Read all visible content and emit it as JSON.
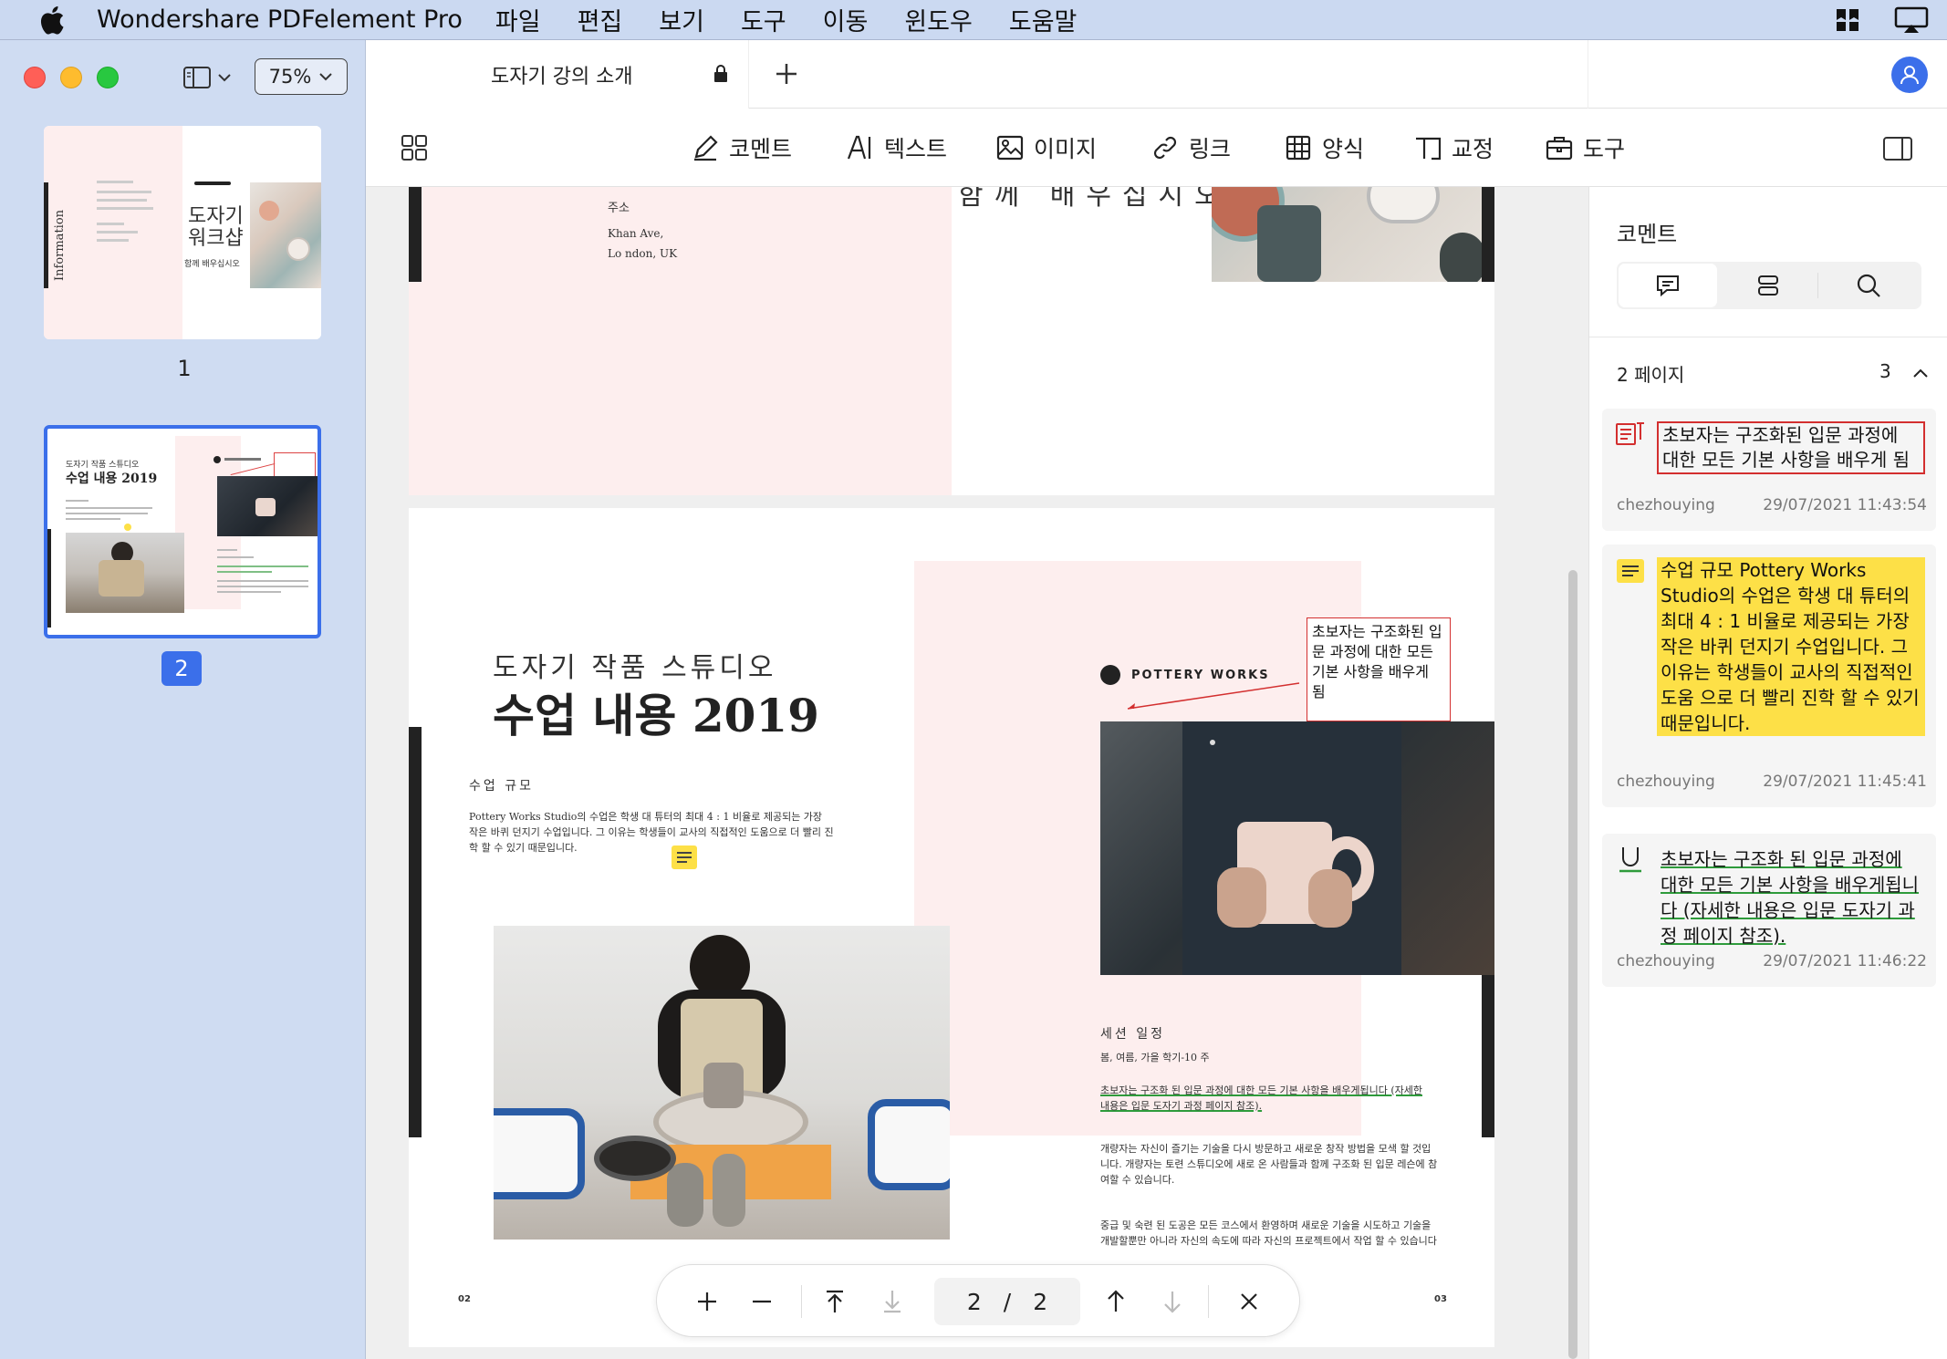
{
  "menubar": {
    "app_name": "Wondershare PDFelement Pro",
    "menus": [
      "파일",
      "편집",
      "보기",
      "도구",
      "이동",
      "윈도우",
      "도움말"
    ]
  },
  "sidebar": {
    "zoom": "75%",
    "thumbnails": [
      {
        "number": "1",
        "selected": false,
        "vertical_text": "Information",
        "title_lines": [
          "도자기",
          "워크샵"
        ],
        "subtitle": "함께 배우십시오"
      },
      {
        "number": "2",
        "selected": true,
        "heading_small": "도자기 작품 스튜디오",
        "heading": "수업 내용 2019"
      }
    ]
  },
  "tab": {
    "title": "도자기 강의 소개"
  },
  "toolbar": {
    "tools": [
      "코멘트",
      "텍스트",
      "이미지",
      "링크",
      "양식",
      "교정",
      "도구"
    ]
  },
  "page1": {
    "address_label": "주소",
    "address_lines": [
      "Khan Ave,",
      "Lo ndon, UK"
    ],
    "headline": "함께 배우십시오"
  },
  "page2": {
    "heading_small": "도자기 작품 스튜디오",
    "heading_main": "수업 내용 2019",
    "section1_title": "수업 규모",
    "section1_body": "Pottery Works Studio의 수업은 학생 대 튜터의 최대 4 : 1 비율로 제공되는 가장 작은 바퀴 던지기 수업입니다. 그 이유는 학생들이 교사의 직접적인 도움으로 더 빨리 진학 할 수 있기 때문입니다.",
    "logo_text": "POTTERY WORKS",
    "callout_text": "초보자는 구조화된 입문 과정에 대한 모든 기본 사항을 배우게 됨",
    "session_title": "세션 일정",
    "session_sub": "봄, 여름, 가을 학기-10 주",
    "underlined_text": "초보자는 구조화 된 입문 과정에 대한 모든 기본 사항을 배우게됩니다 (자세한 내용은 입문 도자기 과정 페이지 참조).",
    "para2": "개량자는 자신이 즐기는 기술을 다시 방문하고 새로운 창작 방법을 모색 할 것입니다. 개량자는 토련 스튜디오에 새로 온 사람들과 함께 구조화 된 입문 레슨에 참여할 수 있습니다.",
    "para3": "중급 및 숙련 된 도공은 모든 코스에서 환영하며 새로운 기술을 시도하고 기술을 개발할뿐만 아니라 자신의 속도에 따라 자신의 프로젝트에서 작업 할 수 있습니다",
    "page_num_left": "02",
    "page_num_right": "03"
  },
  "pager": {
    "current": "2",
    "separator": "/",
    "total": "2"
  },
  "comments": {
    "title": "코멘트",
    "group_label": "2 페이지",
    "group_count": "3",
    "items": [
      {
        "type": "textbox",
        "text": "초보자는 구조화된 입문 과정에 대한 모든 기본 사항을 배우게 됨",
        "author": "chezhouying",
        "time": "29/07/2021 11:43:54"
      },
      {
        "type": "note",
        "text": "수업 규모 Pottery Works Studio의 수업은 학생 대 튜터의 최대 4 : 1 비율로 제공되는 가장 작은 바퀴 던지기 수업입니다. 그 이유는 학생들이 교사의 직접적인 도움 으로 더 빨리 진학 할 수 있기 때문입니다.",
        "author": "chezhouying",
        "time": "29/07/2021 11:45:41"
      },
      {
        "type": "underline",
        "text": "초보자는 구조화 된 입문 과정에 대한 모든 기본 사항을 배우게됩니다 (자세한 내용은 입문 도자기 과정 페이지 참조).",
        "author": "chezhouying",
        "time": "29/07/2021 11:46:22"
      }
    ]
  },
  "colors": {
    "accent": "#3b6fea",
    "highlight": "#fde047",
    "annotation_red": "#d32f2f",
    "underline_green": "#2e9b3b",
    "page_pink": "#fdeeee"
  }
}
